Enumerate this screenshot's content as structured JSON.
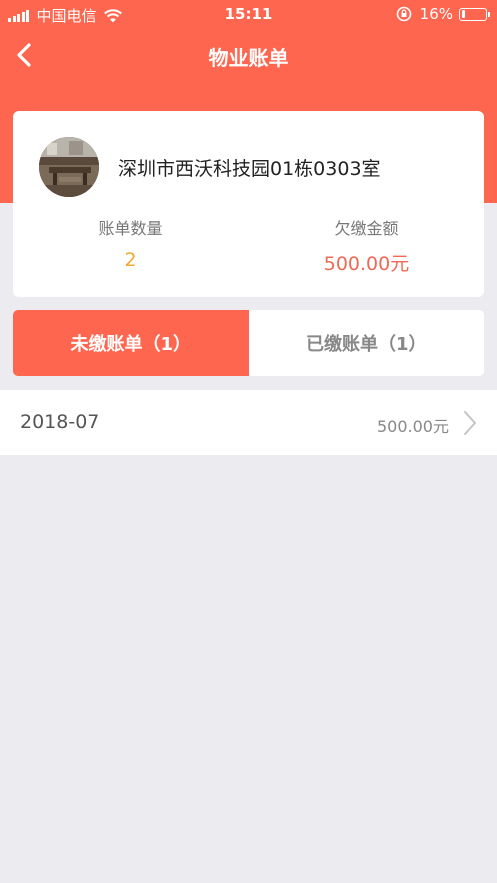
{
  "status_bar": {
    "carrier": "中国电信",
    "time": "15:11",
    "battery": "16%"
  },
  "nav": {
    "title": "物业账单"
  },
  "property": {
    "address": "深圳市西沃科技园01栋0303室"
  },
  "stats": {
    "count_label": "账单数量",
    "count_value": "2",
    "amount_label": "欠缴金额",
    "amount_value": "500.00元"
  },
  "tabs": [
    {
      "label": "未缴账单（1）",
      "active": true
    },
    {
      "label": "已缴账单（1）",
      "active": false
    }
  ],
  "bills": [
    {
      "month": "2018-07",
      "amount": "500.00元"
    }
  ],
  "colors": {
    "accent": "#ff6650",
    "count": "#f0a830",
    "amount": "#ef6a55",
    "background": "#ebebf0"
  },
  "icons": {
    "back": "chevron-left-icon",
    "row_arrow": "chevron-right-icon",
    "wifi": "wifi-icon",
    "lock": "orientation-lock-icon",
    "battery": "battery-icon"
  },
  "battery_level": 0.16
}
